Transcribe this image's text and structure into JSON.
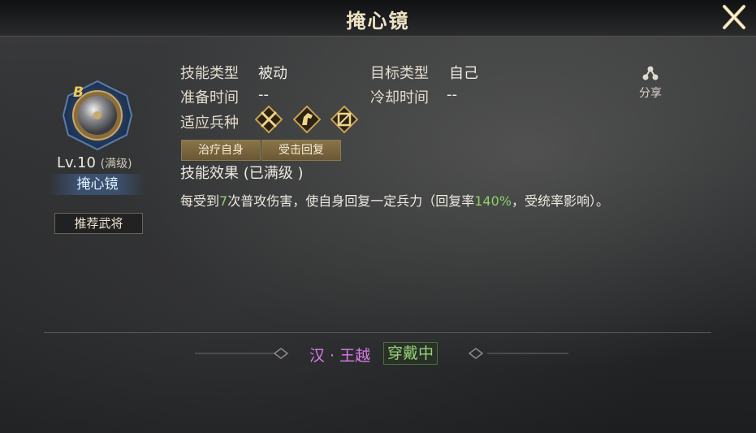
{
  "window": {
    "title": "掩心镜"
  },
  "equipment": {
    "grade": "B",
    "level": "Lv.10",
    "level_note": "(满级)",
    "name": "掩心镜",
    "recommend_button": "推荐武将"
  },
  "info": {
    "skill_type_label": "技能类型",
    "skill_type_value": "被动",
    "target_type_label": "目标类型",
    "target_type_value": "自己",
    "prep_time_label": "准备时间",
    "prep_time_value": "--",
    "cooldown_label": "冷却时间",
    "cooldown_value": "--",
    "troop_label": "适应兵种",
    "troop_icons": [
      "infantry-icon",
      "cavalry-icon",
      "archer-icon"
    ]
  },
  "tags": [
    "治疗自身",
    "受击回复"
  ],
  "effect": {
    "title": "技能效果 (已满级 )",
    "text_1": "每受到",
    "num_1": "7",
    "text_2": "次普攻伤害，使自身回复一定兵力（回复率",
    "num_2": "140%",
    "text_3": "，受统率影响）。"
  },
  "share": {
    "label": "分享"
  },
  "footer": {
    "wearer": "汉 · 王越",
    "status": "穿戴中"
  },
  "colors": {
    "highlight": "#8fd16a",
    "wearer": "#d87ce8",
    "status": "#96d27a",
    "gold": "#f0c85a"
  }
}
